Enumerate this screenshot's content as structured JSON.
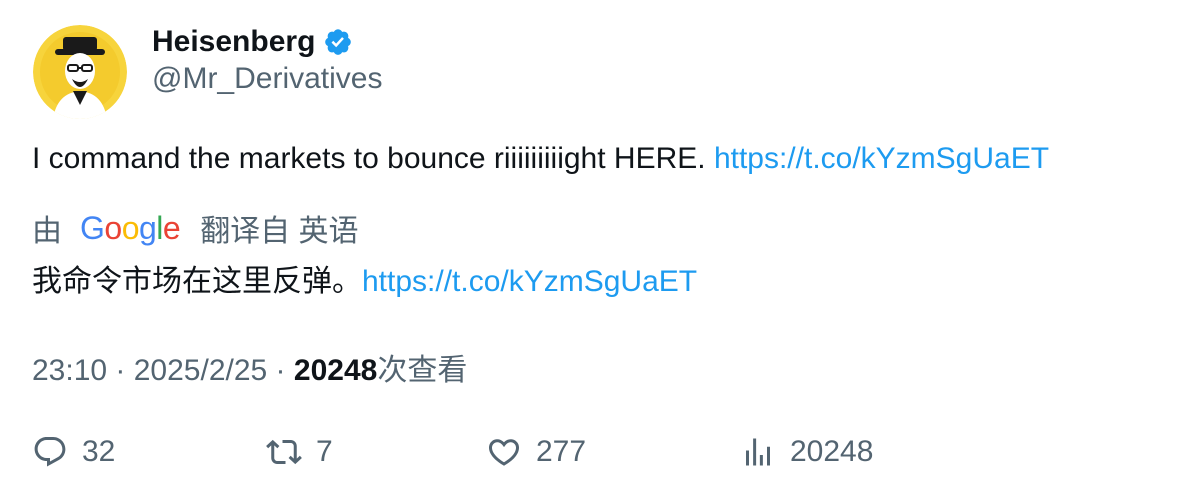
{
  "user": {
    "display_name": "Heisenberg",
    "handle": "@Mr_Derivatives",
    "verified_icon": "verified-badge-icon"
  },
  "tweet": {
    "text": "I command the markets to bounce riiiiiiiiight HERE. ",
    "link": "https://t.co/kYzmSgUaET"
  },
  "translation": {
    "by_label": "由",
    "provider": [
      "G",
      "o",
      "o",
      "g",
      "l",
      "e"
    ],
    "provider_colors": [
      "#4285F4",
      "#EA4335",
      "#FBBC05",
      "#4285F4",
      "#34A853",
      "#EA4335"
    ],
    "from_label": "翻译自 英语",
    "text": "我命令市场在这里反弹。",
    "link": "https://t.co/kYzmSgUaET"
  },
  "meta": {
    "time": "23:10",
    "sep1": " · ",
    "date": "2025/2/25",
    "sep2": " · ",
    "views": "20248",
    "views_label": "次查看"
  },
  "actions": {
    "replies": "32",
    "retweets": "7",
    "likes": "277",
    "views": "20248"
  },
  "colors": {
    "link": "#1d9bf0",
    "secondary_text": "#536471",
    "verified": "#1d9bf0"
  }
}
